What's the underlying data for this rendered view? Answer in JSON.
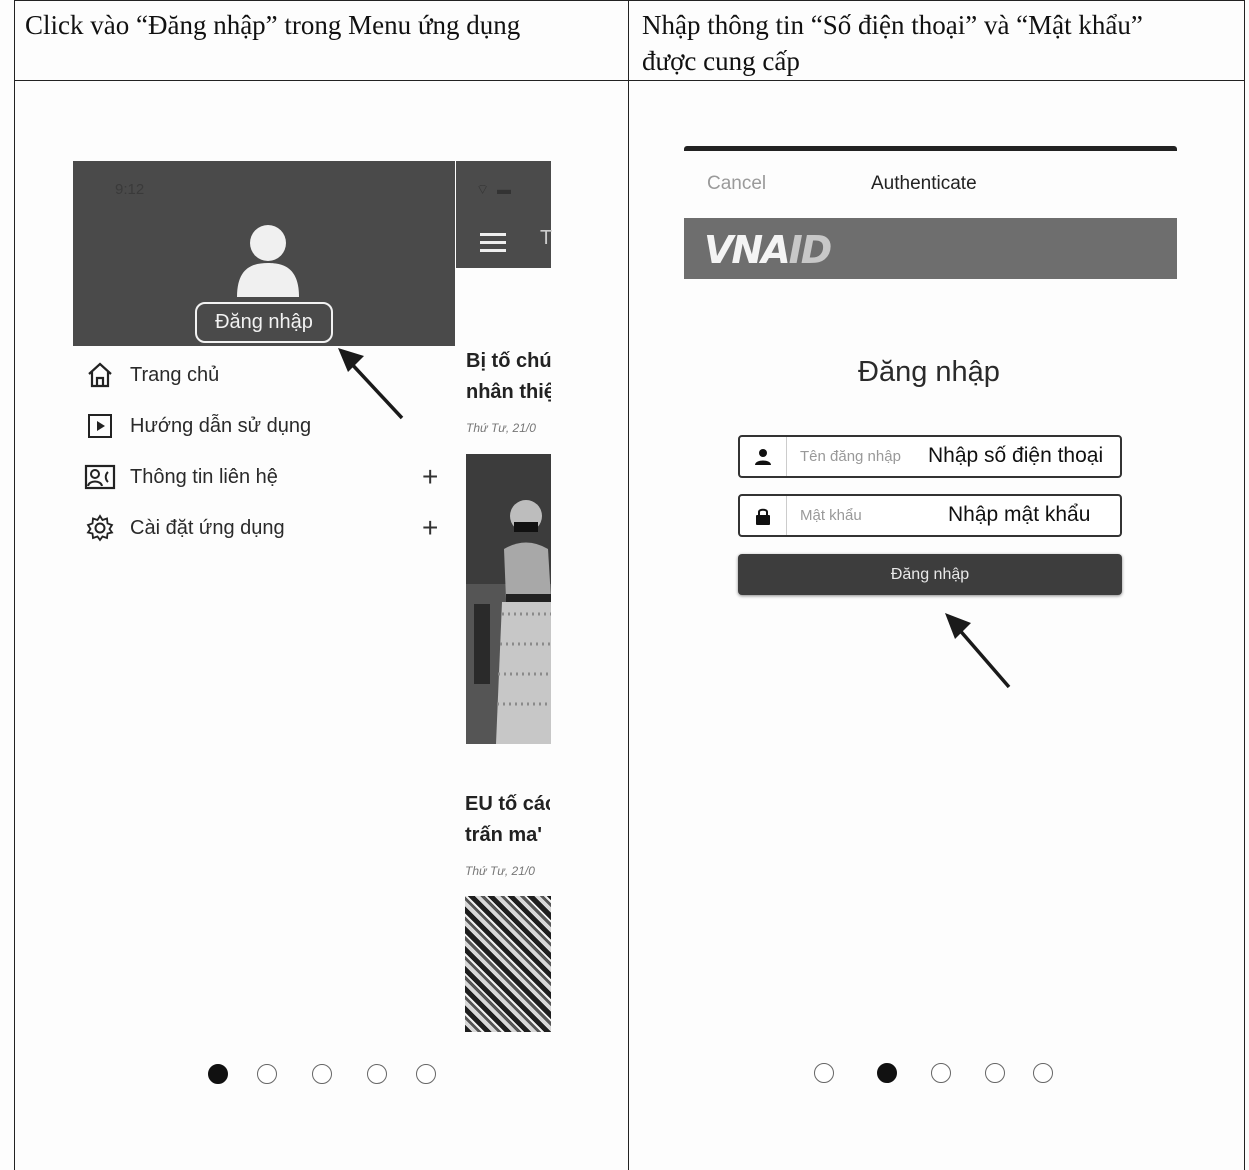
{
  "table": {
    "col1_header": "Click vào “Đăng nhập” trong Menu ứng dụng",
    "col2_header_line1": "Nhập thông tin “Số điện thoại” và “Mật khẩu”",
    "col2_header_line2": "được cung cấp"
  },
  "left_screen": {
    "status_time": "9:12",
    "login_button": "Đăng nhập",
    "menu": [
      {
        "label": "Trang chủ",
        "icon": "home-icon"
      },
      {
        "label": "Hướng dẫn sử dụng",
        "icon": "play-icon"
      },
      {
        "label": "Thông tin liên hệ",
        "icon": "contact-card-icon",
        "expand": "+"
      },
      {
        "label": "Cài đặt ứng dụng",
        "icon": "gear-icon",
        "expand": "+"
      }
    ],
    "strip_letter": "T",
    "news": [
      {
        "title_line1": "Bị tố chú",
        "title_line2": "nhân thiệ",
        "date": "Thứ Tư, 21/0"
      },
      {
        "title_line1": "EU tố các",
        "title_line2": "trấn ma'",
        "date": "Thứ Tư, 21/0"
      }
    ],
    "active_dot": 1
  },
  "right_screen": {
    "cancel": "Cancel",
    "title": "Authenticate",
    "logo": "VNA",
    "logo_suffix": "ID",
    "login_title": "Đăng nhập",
    "username_placeholder": "Tên đăng nhập",
    "username_hint": "Nhập số điện thoại",
    "password_placeholder": "Mật khẩu",
    "password_hint": "Nhập mật khẩu",
    "submit": "Đăng nhập",
    "active_dot": 2
  },
  "colors": {
    "drawer": "#4a4a4a",
    "button_dark": "#3d3d3d",
    "rule": "#222222"
  }
}
